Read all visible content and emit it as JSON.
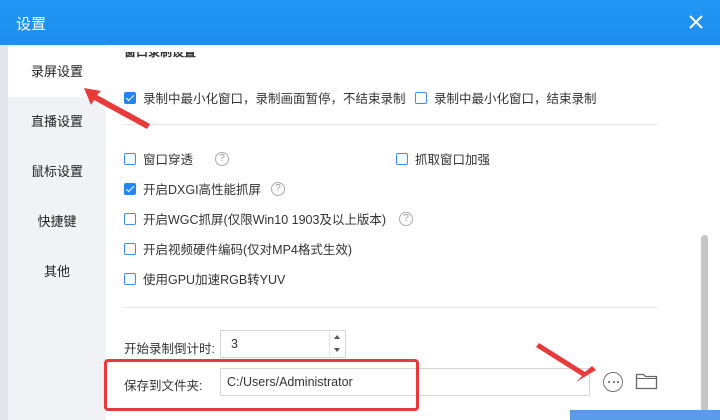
{
  "window": {
    "title": "设置"
  },
  "sidebar": {
    "items": [
      {
        "label": "录屏设置",
        "active": true
      },
      {
        "label": "直播设置",
        "active": false
      },
      {
        "label": "鼠标设置",
        "active": false
      },
      {
        "label": "快捷键",
        "active": false
      },
      {
        "label": "其他",
        "active": false
      }
    ]
  },
  "content": {
    "section_title": "窗口录制设置",
    "options": {
      "pause_on_minimize": {
        "label": "录制中最小化窗口，录制画面暂停，不结束录制",
        "checked": true
      },
      "stop_on_minimize": {
        "label": "录制中最小化窗口，结束录制",
        "checked": false
      },
      "window_through": {
        "label": "窗口穿透",
        "checked": false,
        "help": "?"
      },
      "capture_enhance": {
        "label": "抓取窗口加强",
        "checked": false
      },
      "dxgi": {
        "label": "开启DXGI高性能抓屏",
        "checked": true,
        "help": "?"
      },
      "wgc": {
        "label": "开启WGC抓屏(仅限Win10 1903及以上版本)",
        "checked": false,
        "help": "?"
      },
      "hw_encode": {
        "label": "开启视频硬件编码(仅对MP4格式生效)",
        "checked": false
      },
      "gpu_rgb": {
        "label": "使用GPU加速RGB转YUV",
        "checked": false
      }
    },
    "countdown": {
      "label": "开始录制倒计时:",
      "value": "3"
    },
    "save_folder": {
      "label": "保存到文件夹:",
      "value": "C:/Users/Administrator"
    }
  },
  "colors": {
    "titlebar": "#1e8ef1",
    "accent": "#1f86f2",
    "annotation": "#e83a3a"
  },
  "icons": {
    "close": "close-icon",
    "more": "more-options-icon",
    "folder": "folder-icon",
    "help": "help-icon"
  }
}
